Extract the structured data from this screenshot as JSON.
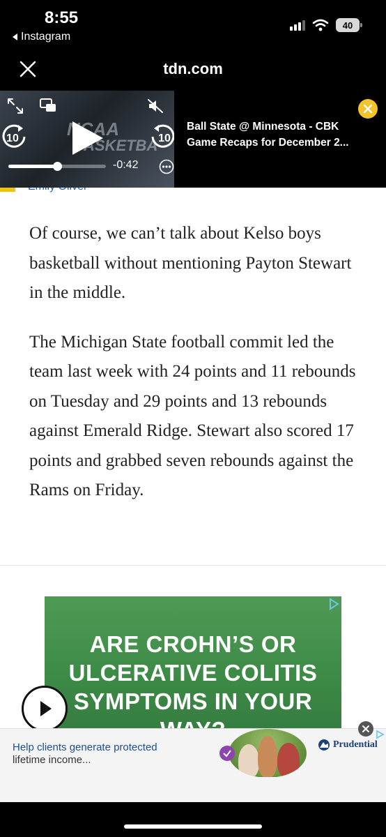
{
  "status_bar": {
    "time": "8:55",
    "back_app": "Instagram",
    "battery": "40"
  },
  "browser": {
    "domain": "tdn.com"
  },
  "video": {
    "remaining": "-0:42",
    "skip_back": "10",
    "skip_forward": "10",
    "progress": 0.5,
    "title_line1": "Ball State @ Minnesota - CBK",
    "title_line2": "Game Recaps for December 2...",
    "thumbnail_text_1": "NCAA",
    "thumbnail_text_2": "ASKETBA"
  },
  "byline": {
    "author": "Emily Oliver"
  },
  "article": {
    "paragraphs": [
      "Of course, we can’t talk about Kelso boys basketball without mentioning Payton Stewart in the middle.",
      "The Michigan State football commit led the team last week with 24 points and 11 rebounds on Tuesday and 29 points and 13 rebounds against Emerald Ridge. Stewart also scored 17 points and grabbed seven rebounds against the Rams on Friday."
    ]
  },
  "ad": {
    "headline_lines": [
      "ARE CROHN’S OR",
      "ULCERATIVE COLITIS",
      "SYMPTOMS IN YOUR WAY?"
    ],
    "bg_color": "#3d8a47"
  },
  "banner_ad": {
    "line1": "Help clients generate protected",
    "line2": "lifetime income...",
    "brand": "Prudential"
  },
  "colors": {
    "accent_yellow": "#f4c22b",
    "link_blue": "#1a5fb4"
  }
}
